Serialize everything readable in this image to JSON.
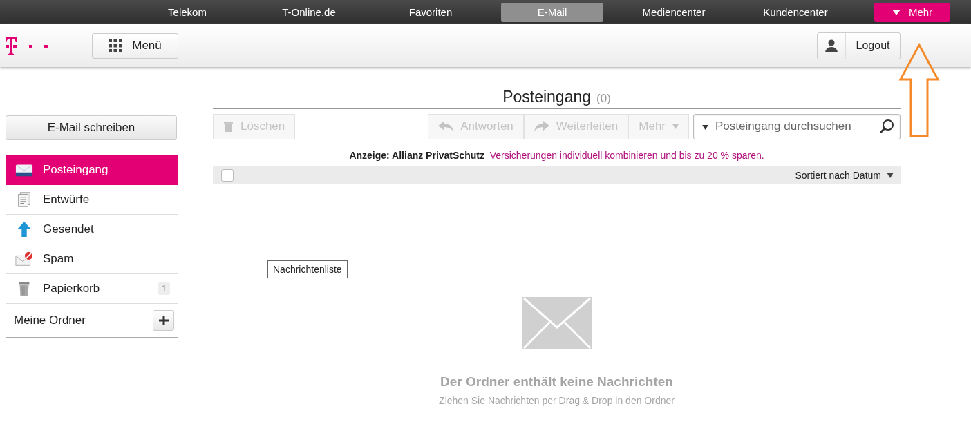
{
  "top_nav": [
    {
      "label": "Telekom",
      "selected": false,
      "kind": "link"
    },
    {
      "label": "T-Online.de",
      "selected": false,
      "kind": "link"
    },
    {
      "label": "Favoriten",
      "selected": false,
      "kind": "link"
    },
    {
      "label": "E-Mail",
      "selected": true,
      "kind": "link"
    },
    {
      "label": "Mediencenter",
      "selected": false,
      "kind": "link"
    },
    {
      "label": "Kundencenter",
      "selected": false,
      "kind": "link"
    },
    {
      "label": "Mehr",
      "selected": false,
      "kind": "dropdown"
    }
  ],
  "header": {
    "menu_button": "Menü",
    "logout_button": "Logout"
  },
  "sidebar": {
    "compose_button": "E-Mail schreiben",
    "folders": [
      {
        "kind": "inbox",
        "label": "Posteingang",
        "selected": true
      },
      {
        "kind": "drafts",
        "label": "Entwürfe",
        "selected": false
      },
      {
        "kind": "sent",
        "label": "Gesendet",
        "selected": false
      },
      {
        "kind": "spam",
        "label": "Spam",
        "selected": false
      },
      {
        "kind": "trash",
        "label": "Papierkorb",
        "selected": false,
        "count": "1"
      }
    ],
    "my_folders_label": "Meine Ordner"
  },
  "content": {
    "title": "Posteingang",
    "count": "(0)",
    "toolbar": {
      "delete": {
        "label": "Löschen",
        "disabled": true
      },
      "actions": [
        {
          "kind": "reply",
          "label": "Antworten",
          "disabled": true
        },
        {
          "kind": "forward",
          "label": "Weiterleiten",
          "disabled": true
        },
        {
          "kind": "more",
          "label": "Mehr",
          "disabled": true
        }
      ],
      "search": {
        "placeholder": "Posteingang durchsuchen"
      }
    },
    "ad": {
      "label": "Anzeige: Allianz PrivatSchutz",
      "text": "Versicherungen individuell kombinieren und bis zu 20 % sparen."
    },
    "list_header": {
      "select_all_checked": false,
      "sort_label": "Sortiert nach Datum"
    },
    "tooltip": "Nachrichtenliste",
    "empty_state": {
      "title": "Der Ordner enthält keine Nachrichten",
      "hint": "Ziehen Sie Nachrichten per Drag & Drop in den Ordner"
    }
  }
}
